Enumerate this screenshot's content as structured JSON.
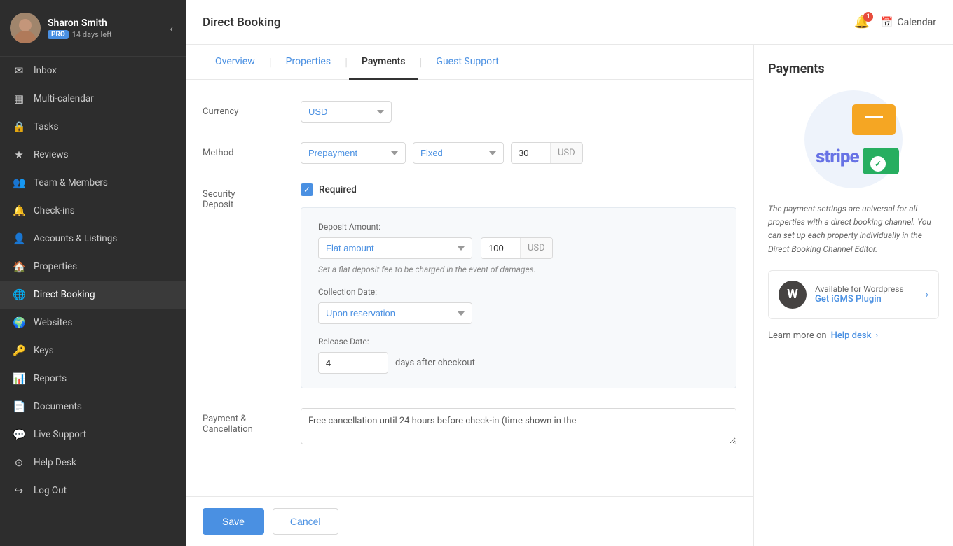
{
  "sidebar": {
    "user": {
      "name": "Sharon Smith",
      "pro_badge": "PRO",
      "days_left": "14 days left"
    },
    "nav_items": [
      {
        "id": "inbox",
        "label": "Inbox",
        "icon": "✉"
      },
      {
        "id": "multi-calendar",
        "label": "Multi-calendar",
        "icon": "▦"
      },
      {
        "id": "tasks",
        "label": "Tasks",
        "icon": "🔒"
      },
      {
        "id": "reviews",
        "label": "Reviews",
        "icon": "★"
      },
      {
        "id": "team-members",
        "label": "Team & Members",
        "icon": "👥"
      },
      {
        "id": "check-ins",
        "label": "Check-ins",
        "icon": "🔔"
      },
      {
        "id": "accounts-listings",
        "label": "Accounts & Listings",
        "icon": "👤"
      },
      {
        "id": "properties",
        "label": "Properties",
        "icon": "🏠"
      },
      {
        "id": "direct-booking",
        "label": "Direct Booking",
        "icon": "🌐"
      },
      {
        "id": "websites",
        "label": "Websites",
        "icon": "🌍"
      },
      {
        "id": "keys",
        "label": "Keys",
        "icon": "🔑"
      },
      {
        "id": "reports",
        "label": "Reports",
        "icon": "📊"
      },
      {
        "id": "documents",
        "label": "Documents",
        "icon": "📄"
      },
      {
        "id": "live-support",
        "label": "Live Support",
        "icon": "💬"
      },
      {
        "id": "help-desk",
        "label": "Help Desk",
        "icon": "⊙"
      },
      {
        "id": "log-out",
        "label": "Log Out",
        "icon": "↪"
      }
    ]
  },
  "topbar": {
    "title": "Direct Booking",
    "notif_count": "1",
    "calendar_label": "Calendar"
  },
  "tabs": [
    {
      "id": "overview",
      "label": "Overview",
      "active": false
    },
    {
      "id": "properties",
      "label": "Properties",
      "active": false
    },
    {
      "id": "payments",
      "label": "Payments",
      "active": true
    },
    {
      "id": "guest-support",
      "label": "Guest Support",
      "active": false
    }
  ],
  "form": {
    "currency_label": "Currency",
    "currency_value": "USD",
    "method_label": "Method",
    "method_value": "Prepayment",
    "fixed_value": "Fixed",
    "amount_value": "30",
    "amount_currency": "USD",
    "security_deposit_label": "Security\nDeposit",
    "required_label": "Required",
    "deposit_amount_label": "Deposit Amount:",
    "deposit_type_value": "Flat amount",
    "deposit_amount_value": "100",
    "deposit_currency": "USD",
    "deposit_hint": "Set a flat deposit fee to be charged in the event of damages.",
    "collection_date_label": "Collection Date:",
    "collection_date_value": "Upon reservation",
    "release_date_label": "Release Date:",
    "release_date_value": "4",
    "release_suffix": "days after checkout",
    "policy_label": "Payment &\nCancellation",
    "policy_value": "Free cancellation until 24 hours before check-in (time shown in the"
  },
  "buttons": {
    "save": "Save",
    "cancel": "Cancel"
  },
  "right_panel": {
    "title": "Payments",
    "description": "The payment settings are universal for all properties with a direct booking channel. You can set up each property individually in the Direct Booking Channel Editor.",
    "wordpress_label": "Available for Wordpress",
    "plugin_label": "Get iGMS Plugin",
    "learn_more": "Learn more on",
    "help_desk": "Help desk"
  }
}
